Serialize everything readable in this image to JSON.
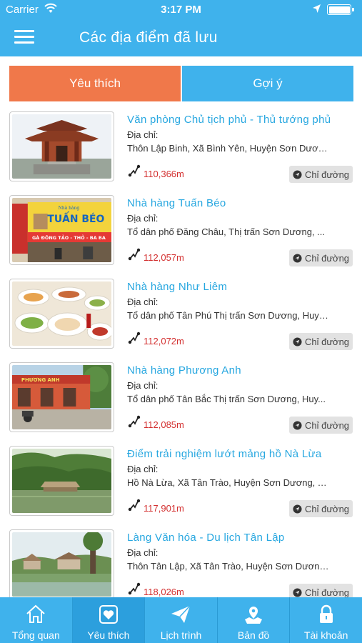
{
  "status_bar": {
    "carrier": "Carrier",
    "time": "3:17 PM"
  },
  "header": {
    "title": "Các địa điểm đã lưu"
  },
  "tabs": [
    {
      "label": "Yêu thích",
      "active": true
    },
    {
      "label": "Gợi ý",
      "active": false
    }
  ],
  "colors": {
    "primary": "#3fb2ec",
    "active_tab": "#f0784a",
    "title_text": "#27a7e0",
    "distance_text": "#d32f2f"
  },
  "places": [
    {
      "name": "Văn phòng Chủ tịch phủ - Thủ tướng phủ",
      "address_label": "Địa chỉ:",
      "address": "Thôn Lập Binh, Xã Bình Yên, Huyện Sơn Dương...",
      "distance": "110,366m",
      "directions_label": "Chỉ đường",
      "image": "pavilion-photo"
    },
    {
      "name": "Nhà hàng Tuấn Béo",
      "address_label": "Địa chỉ:",
      "address": "Tổ dân phố Đăng Châu, Thị trấn Sơn Dương, ...",
      "distance": "112,057m",
      "directions_label": "Chỉ đường",
      "image": "restaurant-sign-photo",
      "image_text": [
        "Nhà hàng",
        "TUẤN BÉO",
        "GÀ ĐÔNG TẢO - THỎ - BA BA"
      ]
    },
    {
      "name": "Nhà hàng Như Liêm",
      "address_label": "Địa chỉ:",
      "address": "Tổ dân phố Tân Phú Thị trấn Sơn Dương, Huyệ...",
      "distance": "112,072m",
      "directions_label": "Chỉ đường",
      "image": "food-table-photo"
    },
    {
      "name": "Nhà hàng Phương Anh",
      "address_label": "Địa chỉ:",
      "address": "Tổ dân phố Tân Bắc Thị trấn Sơn Dương, Huy...",
      "distance": "112,085m",
      "directions_label": "Chỉ đường",
      "image": "restaurant-front-photo",
      "image_text": [
        "PHƯƠNG ANH"
      ]
    },
    {
      "name": "Điểm trải nghiệm lướt mảng hồ Nà Lừa",
      "address_label": "Địa chỉ:",
      "address": "Hồ Nà Lừa, Xã Tân Trào, Huyện Sơn Dương, Tỉ...",
      "distance": "117,901m",
      "directions_label": "Chỉ đường",
      "image": "lake-raft-photo"
    },
    {
      "name": "Làng Văn hóa - Du lịch Tân Lập",
      "address_label": "Địa chỉ:",
      "address": "Thôn Tân Lập, Xã Tân Trào, Huyện Sơn Dương...",
      "distance": "118,026m",
      "directions_label": "Chỉ đường",
      "image": "village-photo"
    }
  ],
  "bottom_tabs": [
    {
      "label": "Tổng quan",
      "icon": "home-icon",
      "selected": false
    },
    {
      "label": "Yêu thích",
      "icon": "heart-icon",
      "selected": true
    },
    {
      "label": "Lịch trình",
      "icon": "paper-plane-icon",
      "selected": false
    },
    {
      "label": "Bản đồ",
      "icon": "map-pin-icon",
      "selected": false
    },
    {
      "label": "Tài khoản",
      "icon": "lock-icon",
      "selected": false
    }
  ]
}
